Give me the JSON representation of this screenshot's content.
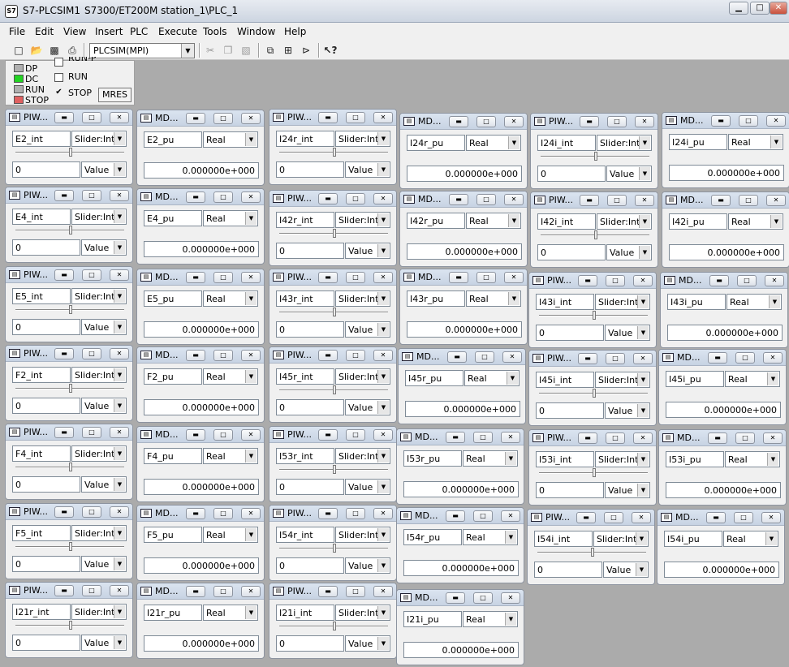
{
  "window": {
    "app": "S7-PLCSIM1",
    "project": "S7300/ET200M station_1\\PLC_1",
    "minimize": "▁",
    "maximize": "□",
    "close": "✕"
  },
  "menu": [
    "File",
    "Edit",
    "View",
    "Insert",
    "PLC",
    "Execute",
    "Tools",
    "Window",
    "Help"
  ],
  "toolbar": {
    "connection": "PLCSIM(MPI)"
  },
  "cpu": {
    "leds": [
      {
        "label": "DP",
        "color": "#b0b0b0"
      },
      {
        "label": "DC",
        "color": "#23d423"
      },
      {
        "label": "RUN",
        "color": "#b0b0b0"
      },
      {
        "label": "STOP",
        "color": "#e06060"
      }
    ],
    "checks": [
      {
        "label": "RUN-P",
        "checked": false
      },
      {
        "label": "RUN",
        "checked": false
      },
      {
        "label": "STOP",
        "checked": true
      }
    ],
    "mres": "MRES"
  },
  "subwindows": [
    {
      "title": "PIW...",
      "addr": "E2_int",
      "fmt": "Slider:Int",
      "val": "0",
      "mode": "Value"
    },
    {
      "title": "MD...",
      "addr": "E2_pu",
      "fmt": "Real",
      "val": "0.000000e+000"
    },
    {
      "title": "PIW...",
      "addr": "I24r_int",
      "fmt": "Slider:Int",
      "val": "0",
      "mode": "Value"
    },
    {
      "title": "MD...",
      "addr": "I24r_pu",
      "fmt": "Real",
      "val": "0.000000e+000"
    },
    {
      "title": "PIW...",
      "addr": "I24i_int",
      "fmt": "Slider:Int",
      "val": "0",
      "mode": "Value"
    },
    {
      "title": "MD...",
      "addr": "I24i_pu",
      "fmt": "Real",
      "val": "0.000000e+000"
    },
    {
      "title": "PIW...",
      "addr": "E4_int",
      "fmt": "Slider:Int",
      "val": "0",
      "mode": "Value"
    },
    {
      "title": "MD...",
      "addr": "E4_pu",
      "fmt": "Real",
      "val": "0.000000e+000"
    },
    {
      "title": "PIW...",
      "addr": "I42r_int",
      "fmt": "Slider:Int",
      "val": "0",
      "mode": "Value"
    },
    {
      "title": "MD...",
      "addr": "I42r_pu",
      "fmt": "Real",
      "val": "0.000000e+000"
    },
    {
      "title": "PIW...",
      "addr": "I42i_int",
      "fmt": "Slider:Int",
      "val": "0",
      "mode": "Value"
    },
    {
      "title": "MD...",
      "addr": "I42i_pu",
      "fmt": "Real",
      "val": "0.000000e+000"
    },
    {
      "title": "PIW...",
      "addr": "E5_int",
      "fmt": "Slider:Int",
      "val": "0",
      "mode": "Value"
    },
    {
      "title": "MD...",
      "addr": "E5_pu",
      "fmt": "Real",
      "val": "0.000000e+000"
    },
    {
      "title": "PIW...",
      "addr": "I43r_int",
      "fmt": "Slider:Int",
      "val": "0",
      "mode": "Value"
    },
    {
      "title": "MD...",
      "addr": "I43r_pu",
      "fmt": "Real",
      "val": "0.000000e+000"
    },
    {
      "title": "PIW...",
      "addr": "I43i_int",
      "fmt": "Slider:Int",
      "val": "0",
      "mode": "Value"
    },
    {
      "title": "MD...",
      "addr": "I43i_pu",
      "fmt": "Real",
      "val": "0.000000e+000"
    },
    {
      "title": "PIW...",
      "addr": "F2_int",
      "fmt": "Slider:Int",
      "val": "0",
      "mode": "Value"
    },
    {
      "title": "MD...",
      "addr": "F2_pu",
      "fmt": "Real",
      "val": "0.000000e+000"
    },
    {
      "title": "PIW...",
      "addr": "I45r_int",
      "fmt": "Slider:Int",
      "val": "0",
      "mode": "Value"
    },
    {
      "title": "MD...",
      "addr": "I45r_pu",
      "fmt": "Real",
      "val": "0.000000e+000"
    },
    {
      "title": "PIW...",
      "addr": "I45i_int",
      "fmt": "Slider:Int",
      "val": "0",
      "mode": "Value"
    },
    {
      "title": "MD...",
      "addr": "I45i_pu",
      "fmt": "Real",
      "val": "0.000000e+000"
    },
    {
      "title": "PIW...",
      "addr": "F4_int",
      "fmt": "Slider:Int",
      "val": "0",
      "mode": "Value"
    },
    {
      "title": "MD...",
      "addr": "F4_pu",
      "fmt": "Real",
      "val": "0.000000e+000"
    },
    {
      "title": "PIW...",
      "addr": "I53r_int",
      "fmt": "Slider:Int",
      "val": "0",
      "mode": "Value"
    },
    {
      "title": "MD...",
      "addr": "I53r_pu",
      "fmt": "Real",
      "val": "0.000000e+000"
    },
    {
      "title": "PIW...",
      "addr": "I53i_int",
      "fmt": "Slider:Int",
      "val": "0",
      "mode": "Value"
    },
    {
      "title": "MD...",
      "addr": "I53i_pu",
      "fmt": "Real",
      "val": "0.000000e+000"
    },
    {
      "title": "PIW...",
      "addr": "F5_int",
      "fmt": "Slider:Int",
      "val": "0",
      "mode": "Value"
    },
    {
      "title": "MD...",
      "addr": "F5_pu",
      "fmt": "Real",
      "val": "0.000000e+000"
    },
    {
      "title": "PIW...",
      "addr": "I54r_int",
      "fmt": "Slider:Int",
      "val": "0",
      "mode": "Value"
    },
    {
      "title": "MD...",
      "addr": "I54r_pu",
      "fmt": "Real",
      "val": "0.000000e+000"
    },
    {
      "title": "PIW...",
      "addr": "I54i_int",
      "fmt": "Slider:Int",
      "val": "0",
      "mode": "Value"
    },
    {
      "title": "MD...",
      "addr": "I54i_pu",
      "fmt": "Real",
      "val": "0.000000e+000"
    },
    {
      "title": "PIW...",
      "addr": "I21r_int",
      "fmt": "Slider:Int",
      "val": "0",
      "mode": "Value"
    },
    {
      "title": "MD...",
      "addr": "I21r_pu",
      "fmt": "Real",
      "val": "0.000000e+000"
    },
    {
      "title": "PIW...",
      "addr": "I21i_int",
      "fmt": "Slider:Int",
      "val": "0",
      "mode": "Value"
    },
    {
      "title": "MD...",
      "addr": "I21i_pu",
      "fmt": "Real",
      "val": "0.000000e+000"
    }
  ]
}
